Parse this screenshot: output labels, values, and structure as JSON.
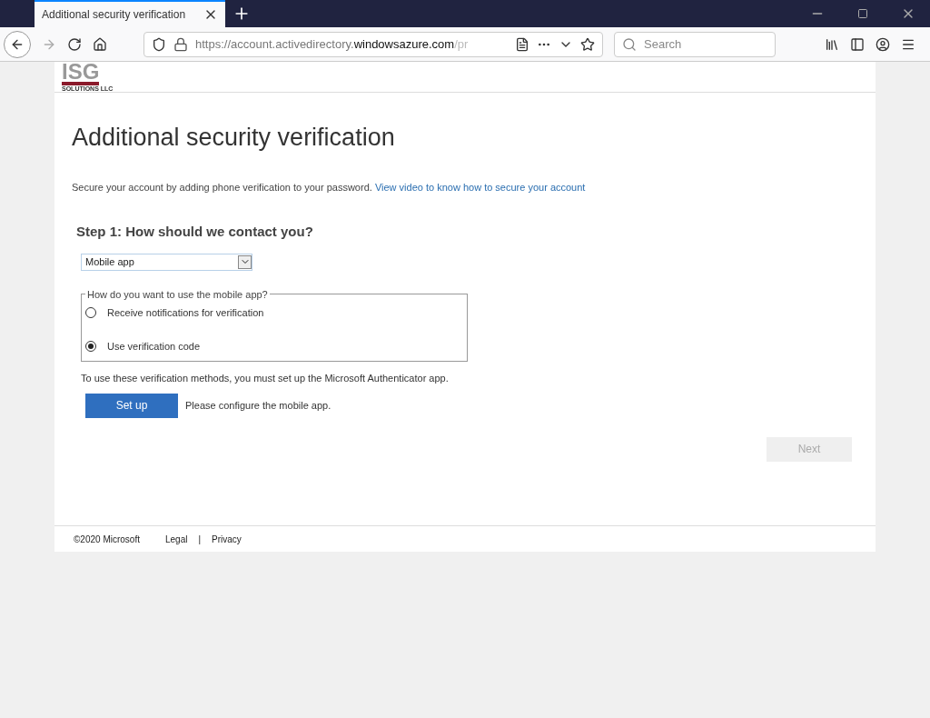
{
  "browser": {
    "tab": {
      "title": "Additional security verification",
      "selected": true
    },
    "url": {
      "prefix": "https://account.activedirectory.",
      "domain": "windowsazure.com",
      "suffix": "/pr"
    },
    "search": {
      "placeholder": "Search"
    }
  },
  "logo": {
    "text": "ISG",
    "subtext": "SOLUTIONS LLC"
  },
  "page": {
    "title": "Additional security verification",
    "intro": "Secure your account by adding phone verification to your password.",
    "intro_link": "View video to know how to secure your account",
    "step": {
      "heading": "Step 1: How should we contact you?",
      "method": "Mobile app",
      "group_label": "How do you want to use the mobile app?",
      "options": [
        {
          "label": "Receive notifications for verification",
          "selected": false
        },
        {
          "label": "Use verification code",
          "selected": true
        }
      ],
      "note": "To use these verification methods, you must set up the Microsoft Authenticator app.",
      "setup_button": "Set up",
      "setup_hint": "Please configure the mobile app."
    },
    "next_button": {
      "label": "Next",
      "disabled": true
    }
  },
  "footer": {
    "copyright": "©2020 Microsoft",
    "links": [
      "Legal",
      "Privacy"
    ],
    "separator": "|"
  }
}
